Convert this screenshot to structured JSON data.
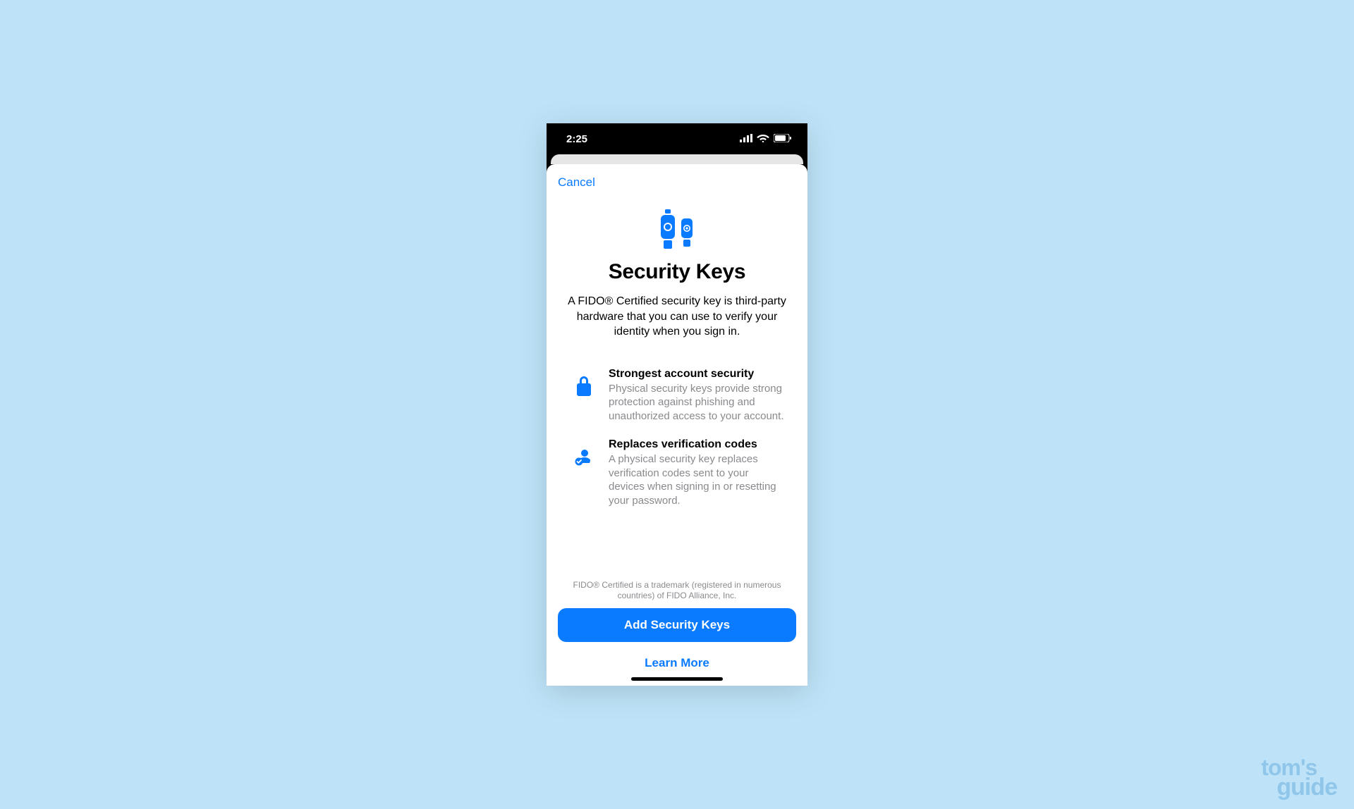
{
  "status_bar": {
    "time": "2:25"
  },
  "sheet": {
    "cancel": "Cancel",
    "title": "Security Keys",
    "subtitle": "A FIDO® Certified security key is third-party hardware that you can use to verify your identity when you sign in.",
    "features": [
      {
        "title": "Strongest account security",
        "desc": "Physical security keys provide strong protection against phishing and unauthorized access to your account."
      },
      {
        "title": "Replaces verification codes",
        "desc": "A physical security key replaces verification codes sent to your devices when signing in or resetting your password."
      }
    ],
    "footnote": "FIDO® Certified is a trademark (registered in numerous countries) of FIDO Alliance, Inc.",
    "primary_button": "Add Security Keys",
    "secondary_button": "Learn More"
  },
  "watermark": {
    "line1": "tom's",
    "line2": "guide"
  }
}
